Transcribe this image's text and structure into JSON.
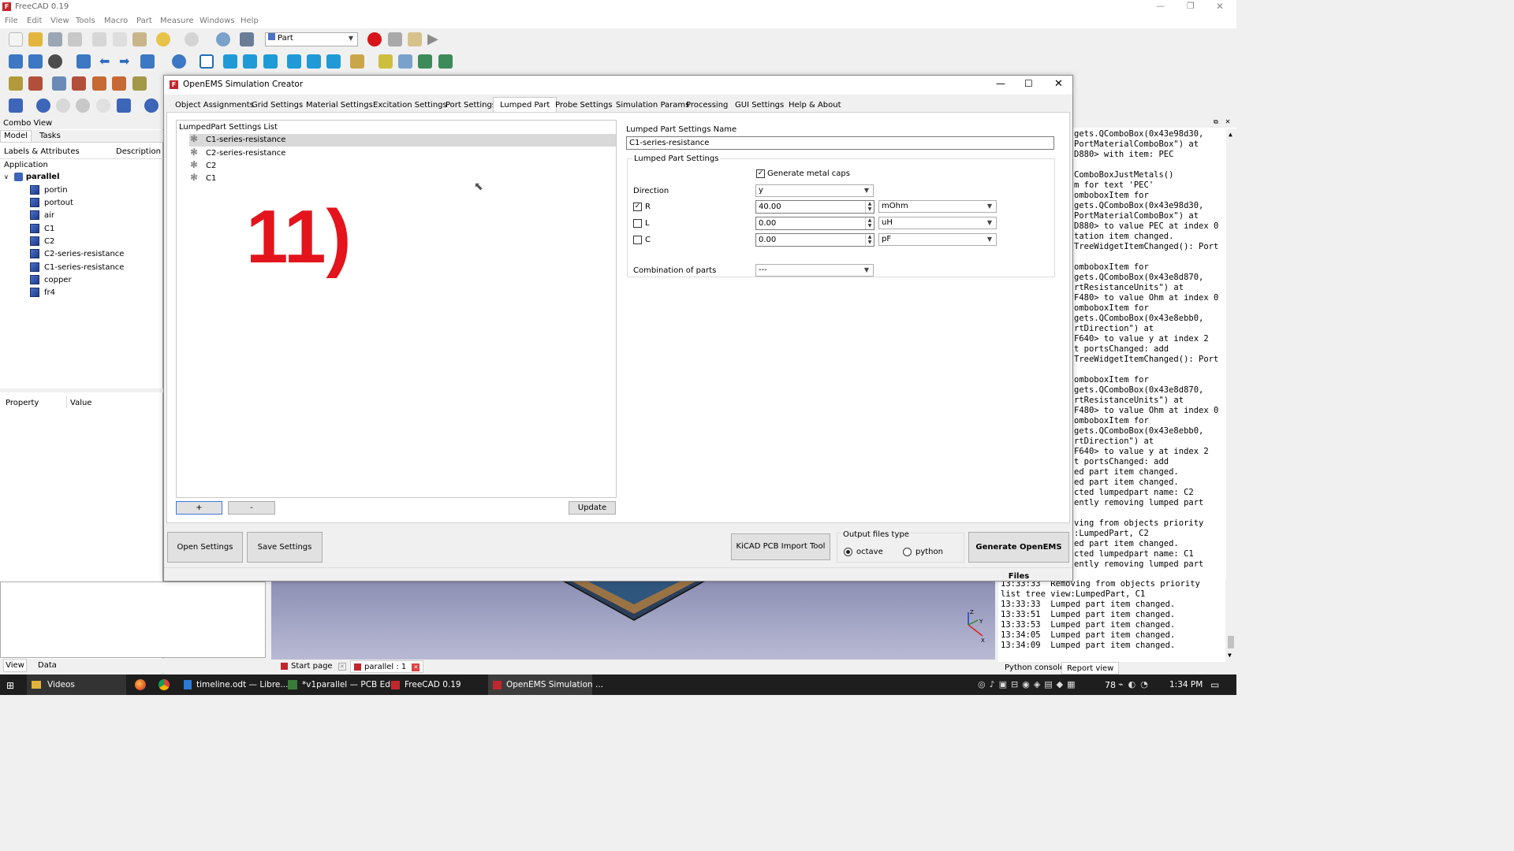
{
  "freecad": {
    "title": "FreeCAD 0.19",
    "menu": [
      "File",
      "Edit",
      "View",
      "Tools",
      "Macro",
      "Part",
      "Measure",
      "Windows",
      "Help"
    ],
    "workbench": "Part"
  },
  "combo_view": {
    "title": "Combo View",
    "tabs": [
      "Model",
      "Tasks"
    ],
    "columns": [
      "Labels & Attributes",
      "Description"
    ],
    "root": "Application",
    "document": "parallel",
    "objects": [
      "portin",
      "portout",
      "air",
      "C1",
      "C2",
      "C2-series-resistance",
      "C1-series-resistance",
      "copper",
      "fr4"
    ],
    "property_columns": [
      "Property",
      "Value"
    ],
    "bottom_tabs": [
      "View",
      "Data"
    ]
  },
  "doc_tabs": [
    "Start page",
    "parallel : 1"
  ],
  "dialog": {
    "title": "OpenEMS Simulation Creator",
    "tabs": [
      "Object Assignments",
      "Grid Settings",
      "Material Settings",
      "Excitation Settings",
      "Port Settings",
      "Lumped Part",
      "Probe Settings",
      "Simulation Params",
      "Processing",
      "GUI Settings",
      "Help & About"
    ],
    "active_tab": "Lumped Part",
    "list_title": "LumpedPart Settings List",
    "list_items": [
      "C1-series-resistance",
      "C2-series-resistance",
      "C2",
      "C1"
    ],
    "overlay_text": "11)",
    "add_label": "+",
    "remove_label": "-",
    "update_label": "Update",
    "name_label": "Lumped Part Settings Name",
    "name_value": "C1-series-resistance",
    "group_label": "Lumped Part Settings",
    "metal_caps_label": "Generate metal caps",
    "direction_label": "Direction",
    "direction_value": "y",
    "r_label": "R",
    "r_value": "40.00",
    "r_unit": "mOhm",
    "l_label": "L",
    "l_value": "0.00",
    "l_unit": "uH",
    "c_label": "C",
    "c_value": "0.00",
    "c_unit": "pF",
    "combination_label": "Combination of parts",
    "combination_value": "---",
    "open_settings": "Open Settings",
    "save_settings": "Save Settings",
    "kicad_tool": "KiCAD PCB Import Tool",
    "output_type_label": "Output files type",
    "octave_label": "octave",
    "python_label": "python",
    "generate_label": "Generate OpenEMS Files"
  },
  "report_lines": [
    "gets.QComboBox(0x43e98d30,",
    "PortMaterialComboBox\") at",
    "D880> with item: PEC",
    "",
    "ComboBoxJustMetals()",
    "m for text 'PEC'",
    "omboboxItem for",
    "gets.QComboBox(0x43e98d30,",
    "PortMaterialComboBox\") at",
    "D880> to value PEC at index 0",
    "tation item changed.",
    "TreeWidgetItemChanged(): Port",
    "",
    "omboboxItem for",
    "gets.QComboBox(0x43e8d870,",
    "rtResistanceUnits\") at",
    "F480> to value Ohm at index 0",
    "omboboxItem for",
    "gets.QComboBox(0x43e8ebb0,",
    "rtDirection\") at",
    "F640> to value y at index 2",
    "t portsChanged: add",
    "TreeWidgetItemChanged(): Port",
    "",
    "omboboxItem for",
    "gets.QComboBox(0x43e8d870,",
    "rtResistanceUnits\") at",
    "F480> to value Ohm at index 0",
    "omboboxItem for",
    "gets.QComboBox(0x43e8ebb0,",
    "rtDirection\") at",
    "F640> to value y at index 2",
    "t portsChanged: add",
    "ed part item changed.",
    "ed part item changed.",
    "cted lumpedpart name: C2",
    "ently removing lumped part",
    "",
    "ving from objects priority",
    ":LumpedPart, C2",
    "ed part item changed.",
    "cted lumpedpart name: C1",
    "ently removing lumped part"
  ],
  "report_lower_lines": [
    "13:33:33  Removing from objects priority",
    "list tree view:LumpedPart, C1",
    "13:33:33  Lumped part item changed.",
    "13:33:51  Lumped part item changed.",
    "13:33:53  Lumped part item changed.",
    "13:34:05  Lumped part item changed.",
    "13:34:09  Lumped part item changed."
  ],
  "report_tabs": [
    "Python console",
    "Report view"
  ],
  "taskbar": {
    "items": [
      "Videos",
      "timeline.odt — Libre...",
      "*v1parallel — PCB Edi...",
      "FreeCAD 0.19",
      "OpenEMS Simulation ..."
    ],
    "battery": "78",
    "time": "1:34 PM"
  }
}
